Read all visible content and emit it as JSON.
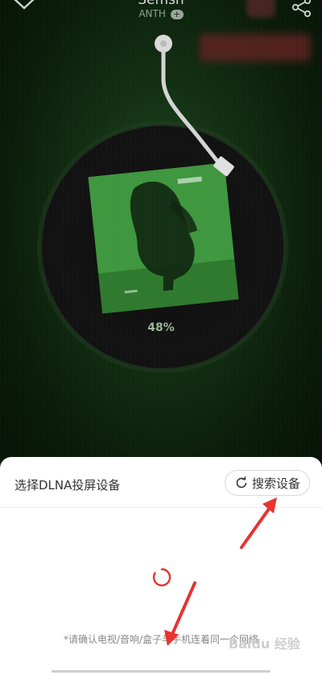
{
  "player": {
    "song_title": "Semsh",
    "artist": "ANTH",
    "follow_symbol": "+",
    "progress_label": "48%"
  },
  "icons": {
    "back": "chevron-down-icon",
    "share": "share-icon",
    "refresh": "refresh-icon",
    "loading": "loading-spinner-icon"
  },
  "sheet": {
    "title": "选择DLNA投屏设备",
    "search_button_label": "搜索设备",
    "notice": "*请确认电视/音响/盒子与手机连着同一个网络"
  },
  "colors": {
    "accent_red": "#e8332f",
    "background_green": "#1f4a1f",
    "sheet_background": "#ffffff"
  },
  "watermark": {
    "text": "Baidu 经验"
  }
}
